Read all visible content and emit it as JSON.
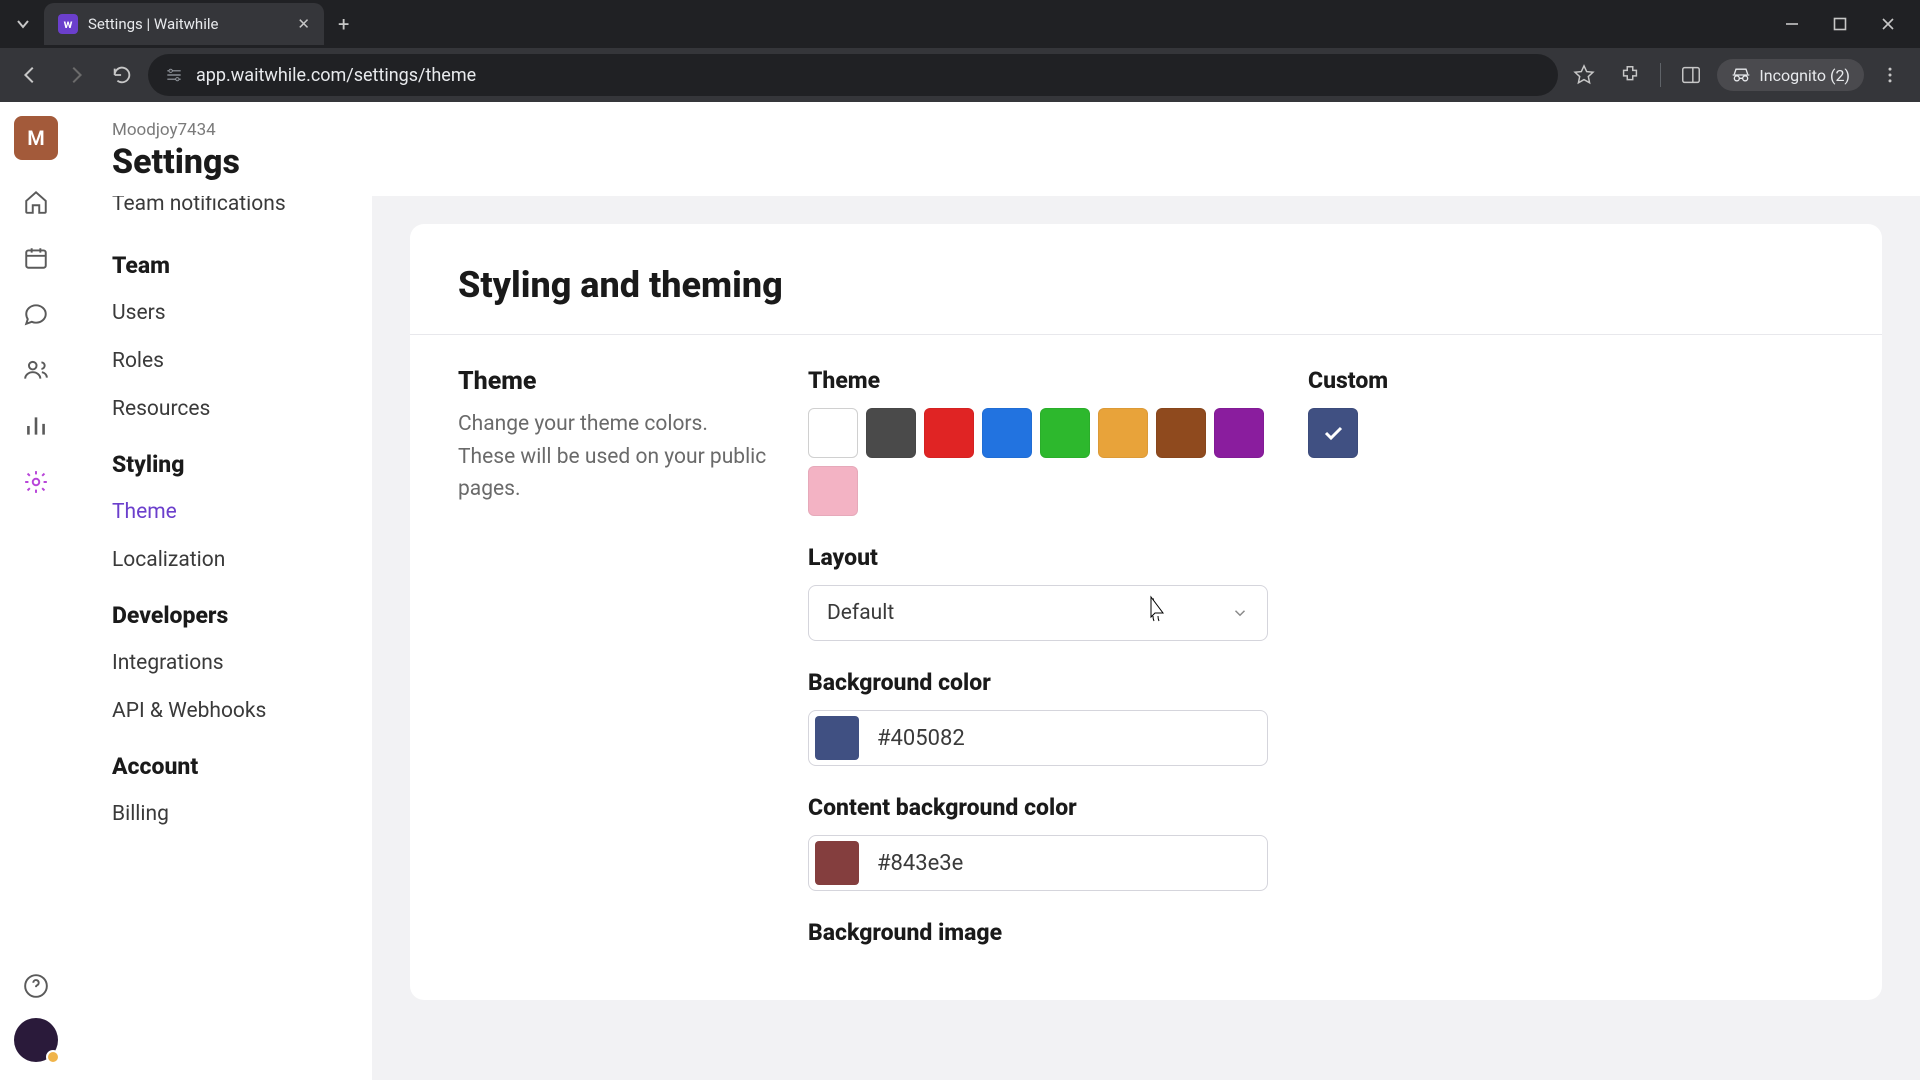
{
  "browser": {
    "tab_title": "Settings | Waitwhile",
    "url": "app.waitwhile.com/settings/theme",
    "incognito_label": "Incognito (2)"
  },
  "header": {
    "avatar_letter": "M",
    "org": "Moodjoy7434",
    "page_title": "Settings"
  },
  "sidebar": {
    "cut_item": "Team notifications",
    "groups": [
      {
        "heading": "Team",
        "items": [
          "Users",
          "Roles",
          "Resources"
        ]
      },
      {
        "heading": "Styling",
        "items": [
          "Theme",
          "Localization"
        ]
      },
      {
        "heading": "Developers",
        "items": [
          "Integrations",
          "API & Webhooks"
        ]
      },
      {
        "heading": "Account",
        "items": [
          "Billing"
        ]
      }
    ],
    "active_item": "Theme"
  },
  "main": {
    "card_title": "Styling and theming",
    "theme_label": "Theme",
    "theme_desc": "Change your theme colors. These will be used on your public pages.",
    "theme_swatch_label": "Theme",
    "custom_label": "Custom",
    "swatch_colors": [
      "#ffffff",
      "#4a4a4a",
      "#e02424",
      "#2273e0",
      "#2db82d",
      "#e8a33a",
      "#8f4a1e",
      "#8a1d9e",
      "#f3b3c4"
    ],
    "custom_swatch_color": "#405082",
    "layout_label": "Layout",
    "layout_value": "Default",
    "bg_label": "Background color",
    "bg_value": "#405082",
    "content_bg_label": "Content background color",
    "content_bg_value": "#843e3e",
    "bg_image_label": "Background image"
  }
}
